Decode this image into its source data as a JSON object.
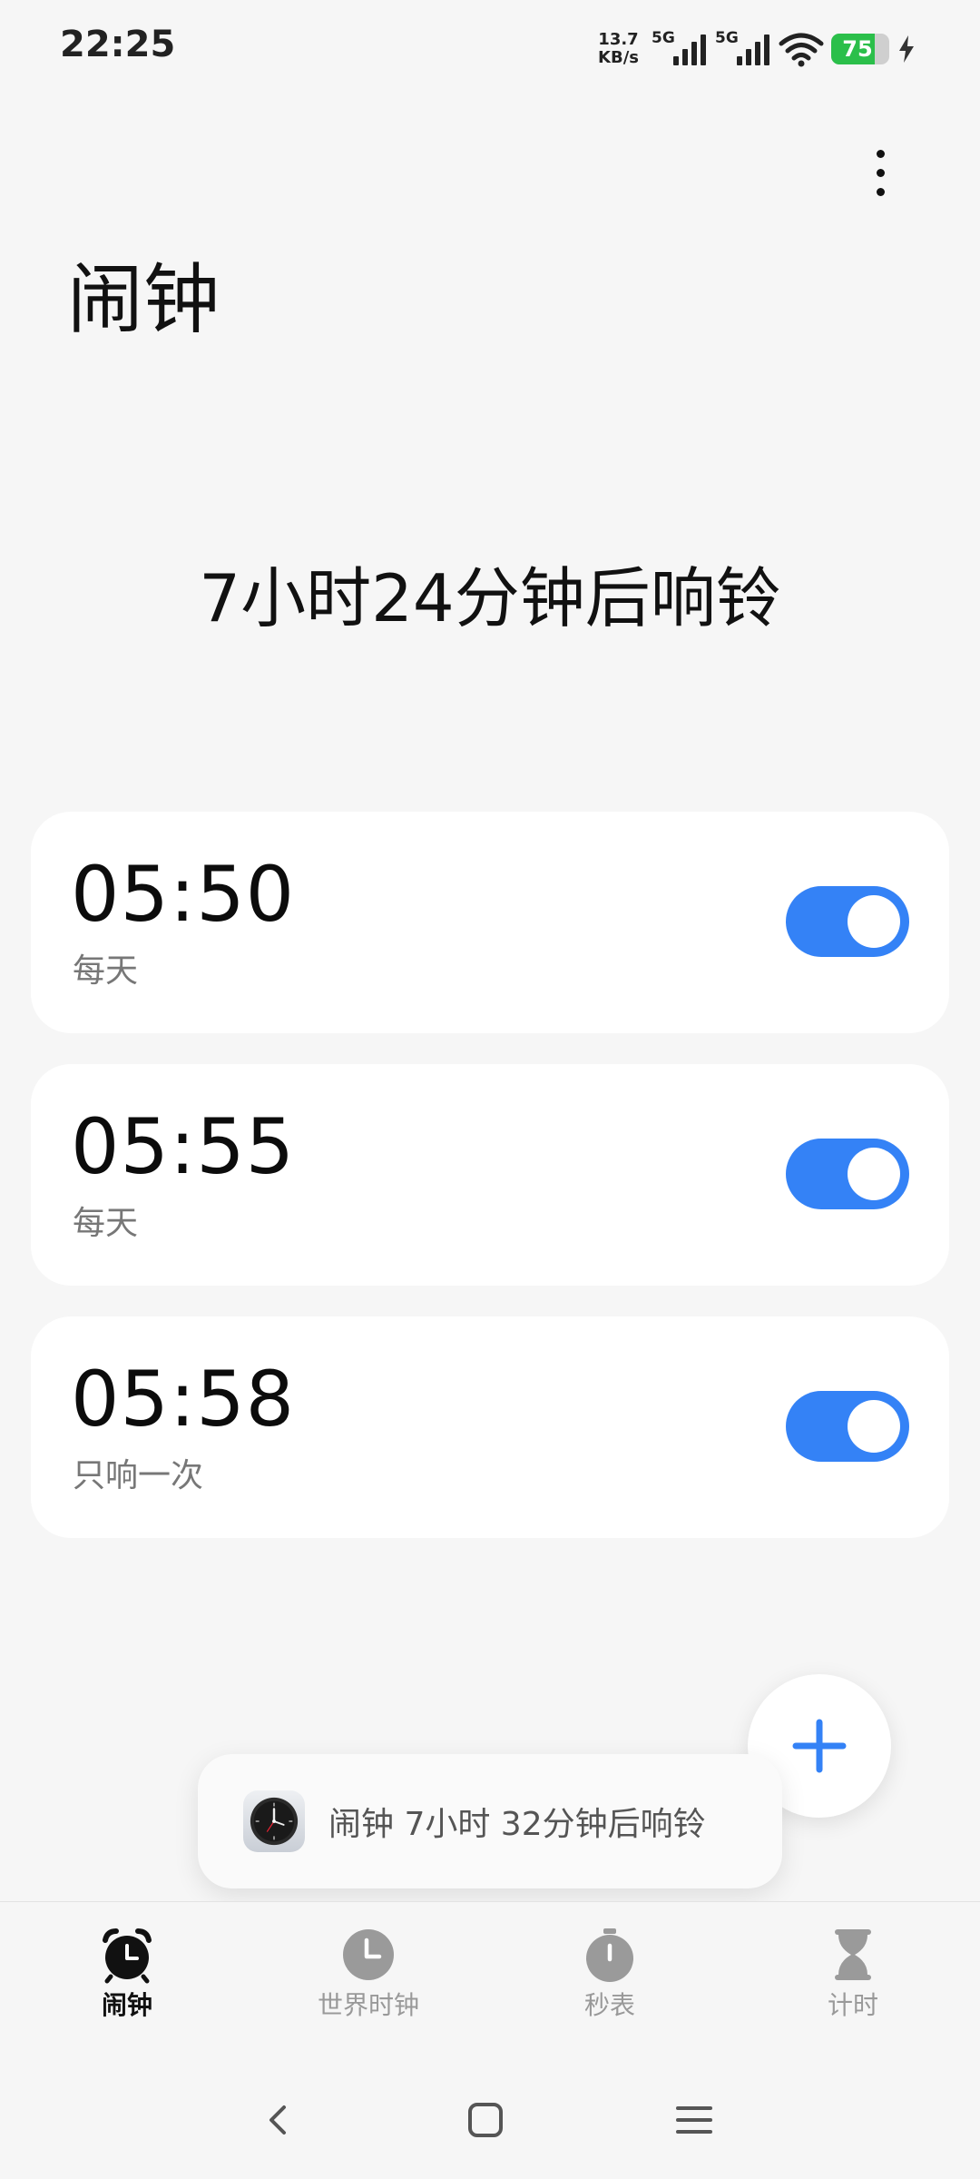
{
  "status_bar": {
    "time": "22:25",
    "net_speed_value": "13.7",
    "net_speed_unit": "KB/s",
    "sim1_tag": "5G",
    "sim2_tag": "5G",
    "battery_level": "75",
    "battery_fraction": 0.75,
    "icons": [
      "signal-icon",
      "signal-icon",
      "wifi-icon",
      "battery-icon",
      "charging-icon"
    ]
  },
  "header": {
    "title": "闹钟",
    "menu_icon": "more-vertical-icon"
  },
  "next_alarm_text": "7小时24分钟后响铃",
  "alarms": [
    {
      "time": "05:50",
      "repeat": "每天",
      "enabled": true
    },
    {
      "time": "05:55",
      "repeat": "每天",
      "enabled": true
    },
    {
      "time": "05:58",
      "repeat": "只响一次",
      "enabled": true
    }
  ],
  "fab": {
    "icon": "plus-icon"
  },
  "toast": {
    "icon": "clock-app-icon",
    "text": "闹钟 7小时 32分钟后响铃"
  },
  "bottom_nav": {
    "items": [
      {
        "label": "闹钟",
        "icon": "alarm-clock-icon",
        "active": true
      },
      {
        "label": "世界时钟",
        "icon": "clock-icon",
        "active": false
      },
      {
        "label": "秒表",
        "icon": "stopwatch-icon",
        "active": false
      },
      {
        "label": "计时",
        "icon": "hourglass-icon",
        "active": false
      }
    ]
  },
  "colors": {
    "background": "#f6f6f6",
    "card": "#ffffff",
    "accent": "#3482f6",
    "battery_green": "#2bbf4a",
    "inactive_nav": "#999999"
  }
}
